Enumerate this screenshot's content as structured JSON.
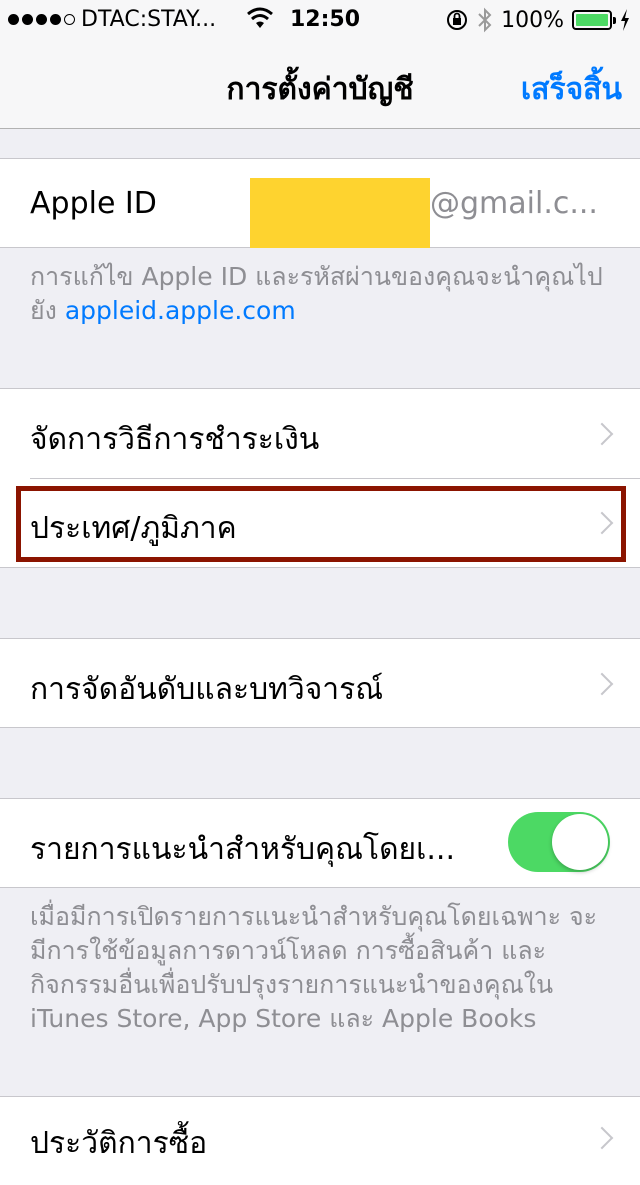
{
  "status_bar": {
    "carrier": "DTAC:STAY...",
    "time": "12:50",
    "battery": "100%",
    "signal_bars": 4,
    "signal_icon": "signal-dots-icon",
    "wifi_icon": "wifi-icon",
    "lock_icon": "rotation-lock-icon",
    "bluetooth_icon": "bluetooth-icon",
    "charging_icon": "charging-bolt-icon"
  },
  "nav": {
    "title": "การตั้งค่าบัญชี",
    "done_label": "เสร็จสิ้น"
  },
  "apple_id": {
    "label": "Apple ID",
    "email_suffix": "@gmail.c...",
    "footer_text": "การแก้ไข Apple ID และรหัสผ่านของคุณจะนำคุณไปยัง",
    "footer_link": "appleid.apple.com"
  },
  "rows": {
    "payment": "จัดการวิธีการชำระเงิน",
    "country": "ประเทศ/ภูมิภาค",
    "ratings": "การจัดอันดับและบทวิจารณ์",
    "personalized": "รายการแนะนำสำหรับคุณโดยเ...",
    "history": "ประวัติการซื้อ"
  },
  "personalized_on": true,
  "personalized_footer": "เมื่อมีการเปิดรายการแนะนำสำหรับคุณโดยเฉพาะ จะมีการใช้ข้อมูลการดาวน์โหลด การซื้อสินค้า และกิจกรรมอื่นเพื่อปรับปรุงรายการแนะนำของคุณใน iTunes Store, App Store และ Apple Books",
  "colors": {
    "accent": "#007aff",
    "toggle_on": "#4cd964",
    "highlight_border": "#8b1400",
    "redaction": "#fed32f"
  }
}
